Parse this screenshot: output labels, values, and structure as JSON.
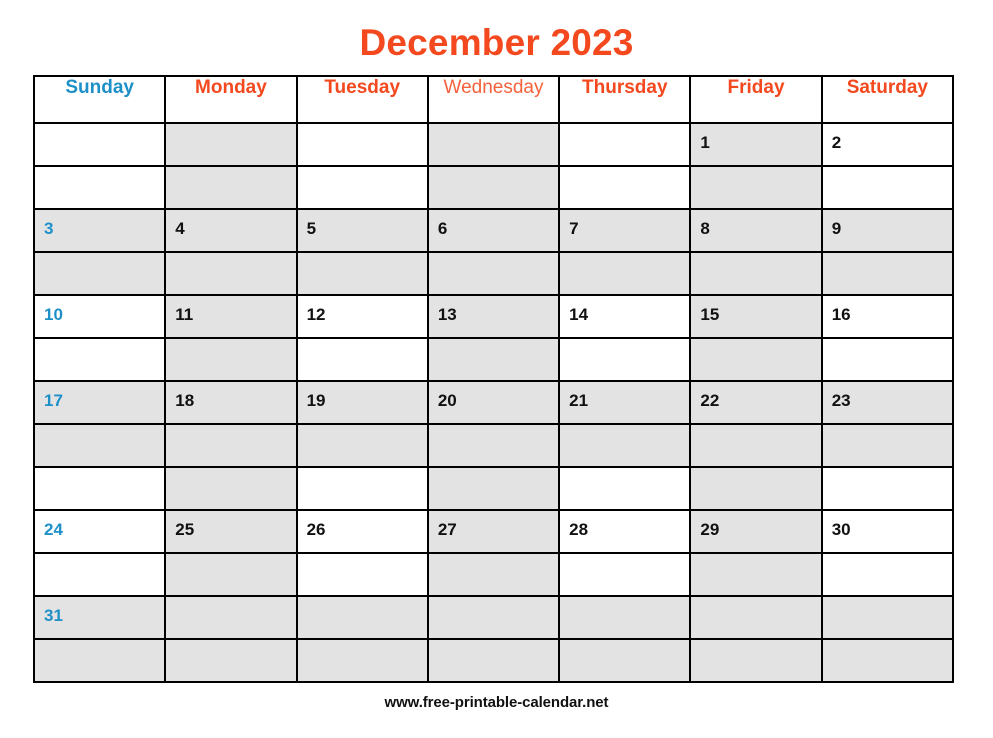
{
  "title": "December 2023",
  "footer": "www.free-printable-calendar.net",
  "colors": {
    "title": "#f4491e",
    "weekday_red": "#f4491e",
    "weekday_wednesday": "#f4613a",
    "sunday_blue": "#1e90c8",
    "daynum_black": "#111111",
    "cell_gray": "#e3e3e3",
    "cell_white": "#ffffff",
    "border": "#000000"
  },
  "weekdays": [
    {
      "label": "Sunday",
      "style": "sun"
    },
    {
      "label": "Monday",
      "style": "red"
    },
    {
      "label": "Tuesday",
      "style": "red"
    },
    {
      "label": "Wednesday",
      "style": "light"
    },
    {
      "label": "Thursday",
      "style": "red"
    },
    {
      "label": "Friday",
      "style": "red"
    },
    {
      "label": "Saturday",
      "style": "red"
    }
  ],
  "weeks": [
    {
      "rows": [
        {
          "cells": [
            {
              "day": "",
              "shade": "white"
            },
            {
              "day": "",
              "shade": "gray"
            },
            {
              "day": "",
              "shade": "white"
            },
            {
              "day": "",
              "shade": "gray"
            },
            {
              "day": "",
              "shade": "white"
            },
            {
              "day": "1",
              "shade": "gray",
              "color": "black"
            },
            {
              "day": "2",
              "shade": "white",
              "color": "black"
            }
          ]
        },
        {
          "cells": [
            {
              "day": "",
              "shade": "white"
            },
            {
              "day": "",
              "shade": "gray"
            },
            {
              "day": "",
              "shade": "white"
            },
            {
              "day": "",
              "shade": "gray"
            },
            {
              "day": "",
              "shade": "white"
            },
            {
              "day": "",
              "shade": "gray"
            },
            {
              "day": "",
              "shade": "white"
            }
          ]
        }
      ]
    },
    {
      "rows": [
        {
          "cells": [
            {
              "day": "3",
              "shade": "gray",
              "color": "sunday"
            },
            {
              "day": "4",
              "shade": "gray",
              "color": "black"
            },
            {
              "day": "5",
              "shade": "gray",
              "color": "black"
            },
            {
              "day": "6",
              "shade": "gray",
              "color": "black"
            },
            {
              "day": "7",
              "shade": "gray",
              "color": "black"
            },
            {
              "day": "8",
              "shade": "gray",
              "color": "black"
            },
            {
              "day": "9",
              "shade": "gray",
              "color": "black"
            }
          ]
        },
        {
          "cells": [
            {
              "day": "",
              "shade": "gray"
            },
            {
              "day": "",
              "shade": "gray"
            },
            {
              "day": "",
              "shade": "gray"
            },
            {
              "day": "",
              "shade": "gray"
            },
            {
              "day": "",
              "shade": "gray"
            },
            {
              "day": "",
              "shade": "gray"
            },
            {
              "day": "",
              "shade": "gray"
            }
          ]
        }
      ]
    },
    {
      "rows": [
        {
          "cells": [
            {
              "day": "10",
              "shade": "white",
              "color": "sunday"
            },
            {
              "day": "11",
              "shade": "gray",
              "color": "black"
            },
            {
              "day": "12",
              "shade": "white",
              "color": "black"
            },
            {
              "day": "13",
              "shade": "gray",
              "color": "black"
            },
            {
              "day": "14",
              "shade": "white",
              "color": "black"
            },
            {
              "day": "15",
              "shade": "gray",
              "color": "black"
            },
            {
              "day": "16",
              "shade": "white",
              "color": "black"
            }
          ]
        },
        {
          "cells": [
            {
              "day": "",
              "shade": "white"
            },
            {
              "day": "",
              "shade": "gray"
            },
            {
              "day": "",
              "shade": "white"
            },
            {
              "day": "",
              "shade": "gray"
            },
            {
              "day": "",
              "shade": "white"
            },
            {
              "day": "",
              "shade": "gray"
            },
            {
              "day": "",
              "shade": "white"
            }
          ]
        }
      ]
    },
    {
      "rows": [
        {
          "cells": [
            {
              "day": "17",
              "shade": "gray",
              "color": "sunday"
            },
            {
              "day": "18",
              "shade": "gray",
              "color": "black"
            },
            {
              "day": "19",
              "shade": "gray",
              "color": "black"
            },
            {
              "day": "20",
              "shade": "gray",
              "color": "black"
            },
            {
              "day": "21",
              "shade": "gray",
              "color": "black"
            },
            {
              "day": "22",
              "shade": "gray",
              "color": "black"
            },
            {
              "day": "23",
              "shade": "gray",
              "color": "black"
            }
          ]
        },
        {
          "cells": [
            {
              "day": "",
              "shade": "gray"
            },
            {
              "day": "",
              "shade": "gray"
            },
            {
              "day": "",
              "shade": "gray"
            },
            {
              "day": "",
              "shade": "gray"
            },
            {
              "day": "",
              "shade": "gray"
            },
            {
              "day": "",
              "shade": "gray"
            },
            {
              "day": "",
              "shade": "gray"
            }
          ]
        },
        {
          "cells": [
            {
              "day": "",
              "shade": "white"
            },
            {
              "day": "",
              "shade": "gray"
            },
            {
              "day": "",
              "shade": "white"
            },
            {
              "day": "",
              "shade": "gray"
            },
            {
              "day": "",
              "shade": "white"
            },
            {
              "day": "",
              "shade": "gray"
            },
            {
              "day": "",
              "shade": "white"
            }
          ]
        }
      ]
    },
    {
      "rows": [
        {
          "cells": [
            {
              "day": "24",
              "shade": "white",
              "color": "sunday"
            },
            {
              "day": "25",
              "shade": "gray",
              "color": "black"
            },
            {
              "day": "26",
              "shade": "white",
              "color": "black"
            },
            {
              "day": "27",
              "shade": "gray",
              "color": "black"
            },
            {
              "day": "28",
              "shade": "white",
              "color": "black"
            },
            {
              "day": "29",
              "shade": "gray",
              "color": "black"
            },
            {
              "day": "30",
              "shade": "white",
              "color": "black"
            }
          ]
        },
        {
          "cells": [
            {
              "day": "",
              "shade": "white"
            },
            {
              "day": "",
              "shade": "gray"
            },
            {
              "day": "",
              "shade": "white"
            },
            {
              "day": "",
              "shade": "gray"
            },
            {
              "day": "",
              "shade": "white"
            },
            {
              "day": "",
              "shade": "gray"
            },
            {
              "day": "",
              "shade": "white"
            }
          ]
        }
      ]
    },
    {
      "rows": [
        {
          "cells": [
            {
              "day": "31",
              "shade": "gray",
              "color": "sunday"
            },
            {
              "day": "",
              "shade": "gray"
            },
            {
              "day": "",
              "shade": "gray"
            },
            {
              "day": "",
              "shade": "gray"
            },
            {
              "day": "",
              "shade": "gray"
            },
            {
              "day": "",
              "shade": "gray"
            },
            {
              "day": "",
              "shade": "gray"
            }
          ]
        },
        {
          "cells": [
            {
              "day": "",
              "shade": "gray"
            },
            {
              "day": "",
              "shade": "gray"
            },
            {
              "day": "",
              "shade": "gray"
            },
            {
              "day": "",
              "shade": "gray"
            },
            {
              "day": "",
              "shade": "gray"
            },
            {
              "day": "",
              "shade": "gray"
            },
            {
              "day": "",
              "shade": "gray"
            }
          ]
        }
      ]
    }
  ]
}
